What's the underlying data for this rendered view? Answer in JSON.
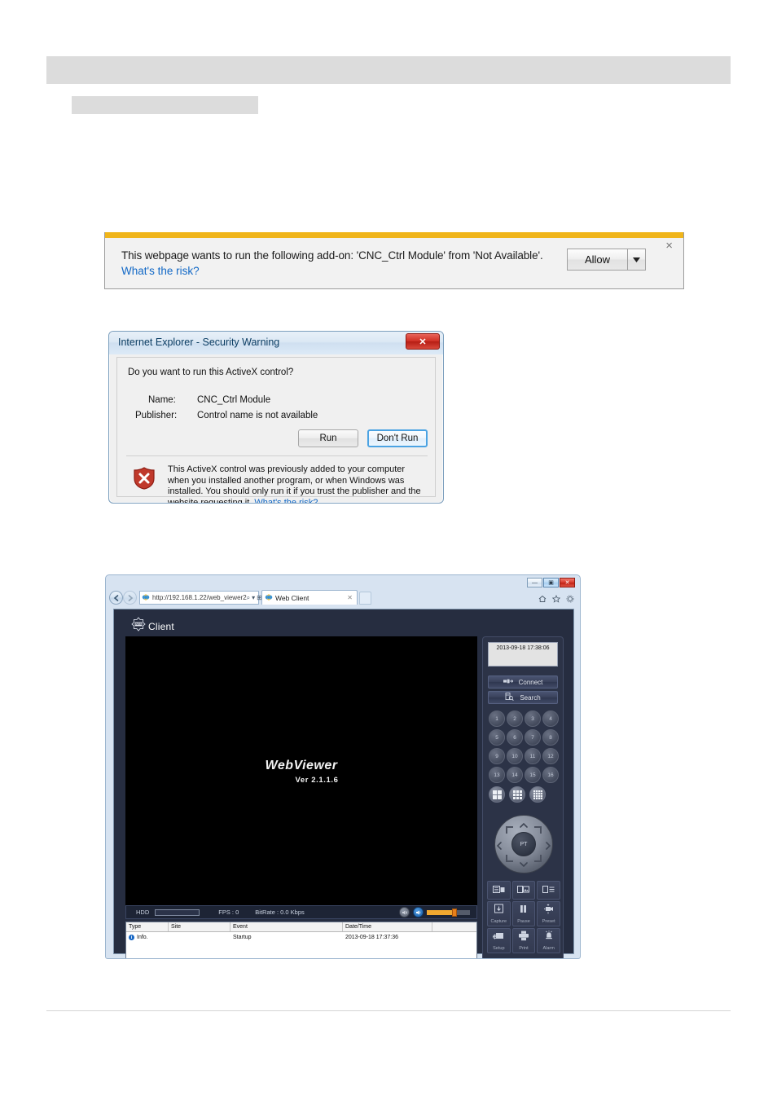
{
  "notification_bar": {
    "message": "This webpage wants to run the following add-on: 'CNC_Ctrl Module' from 'Not Available'.",
    "risk_link": "What's the risk?",
    "allow_label": "Allow",
    "dropdown_icon": "chevron-down-icon",
    "close_icon": "×"
  },
  "activex_dialog": {
    "title": "Internet Explorer - Security Warning",
    "close_label": "✕",
    "question": "Do you want to run this ActiveX control?",
    "name_label": "Name:",
    "name_value": "CNC_Ctrl Module",
    "publisher_label": "Publisher:",
    "publisher_value": "Control name is not available",
    "run_label": "Run",
    "dont_run_label": "Don't Run",
    "warning_text": "This ActiveX control was previously added to your computer when you installed another program, or when Windows was installed. You should only run it if you trust the publisher and the website requesting it.",
    "warning_link": "What's the risk?",
    "shield_icon": "red-shield-icon"
  },
  "browser": {
    "window_controls": {
      "minimize": "—",
      "restore": "▣",
      "close": "✕"
    },
    "back_icon": "back-arrow-icon",
    "forward_icon": "forward-arrow-icon",
    "address": {
      "protocol": "http://",
      "host": "192.168.1.22",
      "path": "/web_viewer2",
      "full": "http://192.168.1.22/web_viewer2",
      "search_icon": "magnifier-icon",
      "compat_icon": "compatibility-view-icon",
      "refresh_icon": "refresh-icon"
    },
    "tab": {
      "label": "Web Client",
      "close": "✕"
    },
    "toolbar_icons": [
      "home-icon",
      "favorites-star-icon",
      "settings-gear-icon"
    ]
  },
  "web_viewer": {
    "logo_text": "Client",
    "logo_badge": "WEB",
    "video": {
      "brand": "WebViewer",
      "version": "Ver 2.1.1.6"
    },
    "status_bar": {
      "hdd_label": "HDD",
      "hdd_percent": 0,
      "fps_label": "FPS :",
      "fps_value": "0",
      "bitrate_label": "BitRate :",
      "bitrate_value": "0.0 Kbps",
      "mute_icon": "mute-icon",
      "speaker_icon": "speaker-icon",
      "volume_percent": 62
    },
    "event_log": {
      "columns": [
        "Type",
        "Site",
        "Event",
        "Date/Time",
        ""
      ],
      "rows": [
        {
          "type": "Info.",
          "site": "",
          "event": "Startup",
          "datetime": "2013-09-18 17:37:36",
          "extra": ""
        }
      ]
    },
    "panel": {
      "clock": "2013-09-18 17:38:06",
      "connect_label": "Connect",
      "connect_icon": "plug-connect-icon",
      "search_label": "Search",
      "search_icon": "search-file-icon",
      "channels": [
        "1",
        "2",
        "3",
        "4",
        "5",
        "6",
        "7",
        "8",
        "9",
        "10",
        "11",
        "12",
        "13",
        "14",
        "15",
        "16"
      ],
      "layouts": [
        {
          "name": "layout-2x2-icon",
          "cells": 2
        },
        {
          "name": "layout-3x3-icon",
          "cells": 3
        },
        {
          "name": "layout-4x4-icon",
          "cells": 4
        }
      ],
      "ptz": {
        "center_label": "PT",
        "up_icon": "chevron-up-icon",
        "down_icon": "chevron-down-icon",
        "left_icon": "chevron-left-icon",
        "right_icon": "chevron-right-icon"
      },
      "tools": [
        {
          "label": "",
          "icon": "dual-monitor-icon"
        },
        {
          "label": "",
          "icon": "monitor-image-icon"
        },
        {
          "label": "",
          "icon": "monitor-list-icon"
        },
        {
          "label": "Capture",
          "icon": "capture-icon"
        },
        {
          "label": "Pause",
          "icon": "pause-icon"
        },
        {
          "label": "Preset",
          "icon": "preset-camera-icon"
        },
        {
          "label": "Setup",
          "icon": "setup-gear-icon"
        },
        {
          "label": "Print",
          "icon": "printer-icon"
        },
        {
          "label": "Alarm",
          "icon": "alarm-bell-icon"
        }
      ]
    }
  },
  "colors": {
    "notif_stripe": "#f0b51a",
    "link": "#1168c6",
    "panel_bg": "#2c3347",
    "video_bg": "#000000",
    "volume": "#f0a830",
    "redaction": "#dcdcdc"
  }
}
